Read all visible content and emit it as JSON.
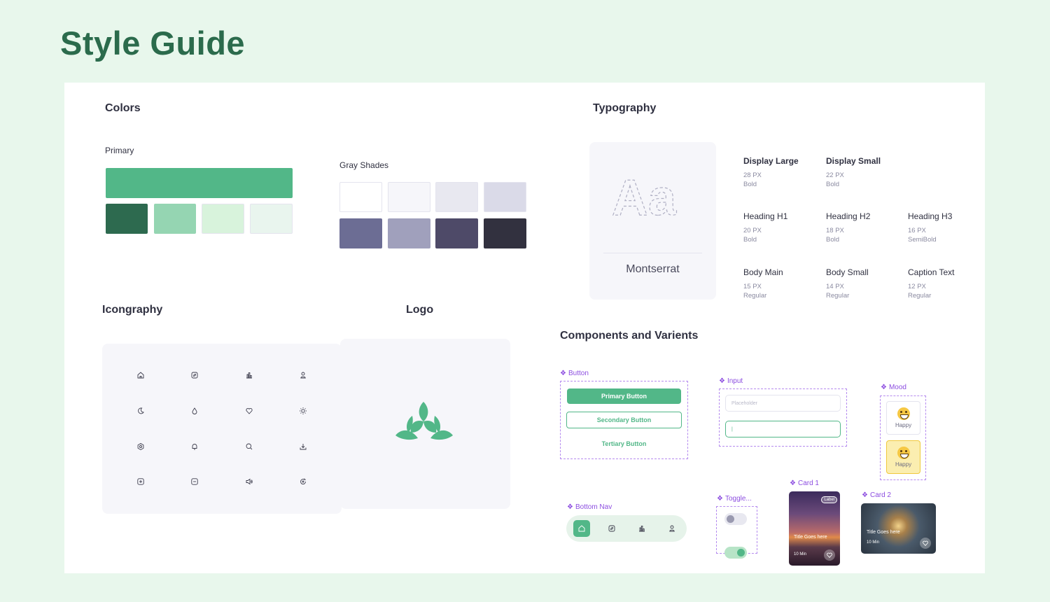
{
  "page": {
    "title": "Style Guide"
  },
  "colors": {
    "section_title": "Colors",
    "primary": {
      "label": "Primary",
      "main": "#52b788",
      "shades": [
        "#2d6a4f",
        "#95d5b2",
        "#d8f3dc",
        "#e9f5ee"
      ]
    },
    "gray": {
      "label": "Gray Shades",
      "row1": [
        "#ffffff",
        "#f6f6fa",
        "#e8e8f0",
        "#dadae8"
      ],
      "row2": [
        "#6c6d94",
        "#a0a0bc",
        "#4e4a68",
        "#32313f"
      ]
    }
  },
  "typography": {
    "section_title": "Typography",
    "specimen_glyph": "Aa",
    "font_name": "Montserrat",
    "styles": [
      {
        "name": "Display Large",
        "size": "28 PX",
        "weight": "Bold"
      },
      {
        "name": "Display Small",
        "size": "22 PX",
        "weight": "Bold"
      },
      {
        "name": "Heading H1",
        "size": "20 PX",
        "weight": "Bold"
      },
      {
        "name": "Heading H2",
        "size": "18 PX",
        "weight": "Bold"
      },
      {
        "name": "Heading H3",
        "size": "16 PX",
        "weight": "SemiBold"
      },
      {
        "name": "Body Main",
        "size": "15 PX",
        "weight": "Regular"
      },
      {
        "name": "Body Small",
        "size": "14 PX",
        "weight": "Regular"
      },
      {
        "name": "Caption Text",
        "size": "12 PX",
        "weight": "Regular"
      }
    ]
  },
  "iconography": {
    "section_title": "Icongraphy",
    "icons": [
      "home-icon",
      "compass-icon",
      "bar-chart-icon",
      "user-icon",
      "moon-icon",
      "drop-icon",
      "heart-icon",
      "sun-icon",
      "settings-icon",
      "bell-icon",
      "search-icon",
      "download-icon",
      "plus-square-icon",
      "minus-square-icon",
      "volume-icon",
      "refresh-icon"
    ]
  },
  "logo": {
    "section_title": "Logo",
    "icon": "lotus-logo-icon",
    "color": "#52b788"
  },
  "components": {
    "section_title": "Components and Varients",
    "button": {
      "tag": "Button",
      "primary": "Primary Button",
      "secondary": "Secondary Button",
      "tertiary": "Tertiary Button"
    },
    "input": {
      "tag": "Input",
      "placeholder": "Placeholder",
      "active_value": "|"
    },
    "mood": {
      "tag": "Mood",
      "items": [
        "Happy",
        "Happy"
      ]
    },
    "bottom_nav": {
      "tag": "Bottom Nav",
      "items": [
        "home-icon",
        "compass-icon",
        "bar-chart-icon",
        "user-icon"
      ]
    },
    "toggle": {
      "tag": "Toggle..."
    },
    "card1": {
      "tag": "Card 1",
      "badge": "Label",
      "title": "Title Goes here",
      "meta": "10 Min"
    },
    "card2": {
      "tag": "Card 2",
      "title": "Title Goes here",
      "meta": "10 Min"
    }
  }
}
